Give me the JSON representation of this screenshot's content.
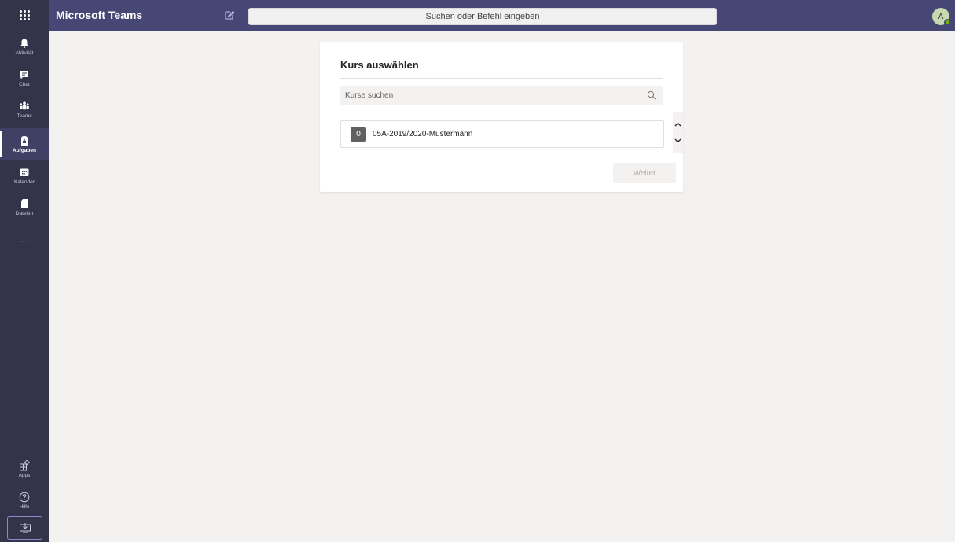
{
  "topbar": {
    "app_title": "Microsoft Teams",
    "search_placeholder": "Suchen oder Befehl eingeben",
    "avatar_initial": "A",
    "presence_color": "#6bb700",
    "icons": [
      "waffle-icon",
      "compose-icon"
    ]
  },
  "rail": {
    "items": [
      {
        "label": "Aktivität",
        "icon": "bell-icon"
      },
      {
        "label": "Chat",
        "icon": "chat-icon"
      },
      {
        "label": "Teams",
        "icon": "teams-icon"
      },
      {
        "label": "Aufgaben",
        "icon": "assignments-icon",
        "active": true
      },
      {
        "label": "Kalender",
        "icon": "calendar-icon"
      },
      {
        "label": "Dateien",
        "icon": "files-icon"
      }
    ],
    "more_label": "...",
    "bottom_items": [
      {
        "label": "Apps",
        "icon": "apps-icon"
      },
      {
        "label": "Hilfe",
        "icon": "help-icon"
      }
    ],
    "download_icon": "download-icon"
  },
  "dialog": {
    "title": "Kurs auswählen",
    "search_placeholder": "Kurse suchen",
    "courses": [
      {
        "badge": "0",
        "name": "05A-2019/2020-Mustermann"
      }
    ],
    "next_label": "Weiter"
  },
  "colors": {
    "topbar": "#464775",
    "rail": "#33344a",
    "background": "#f3f2f1",
    "card": "#ffffff"
  }
}
